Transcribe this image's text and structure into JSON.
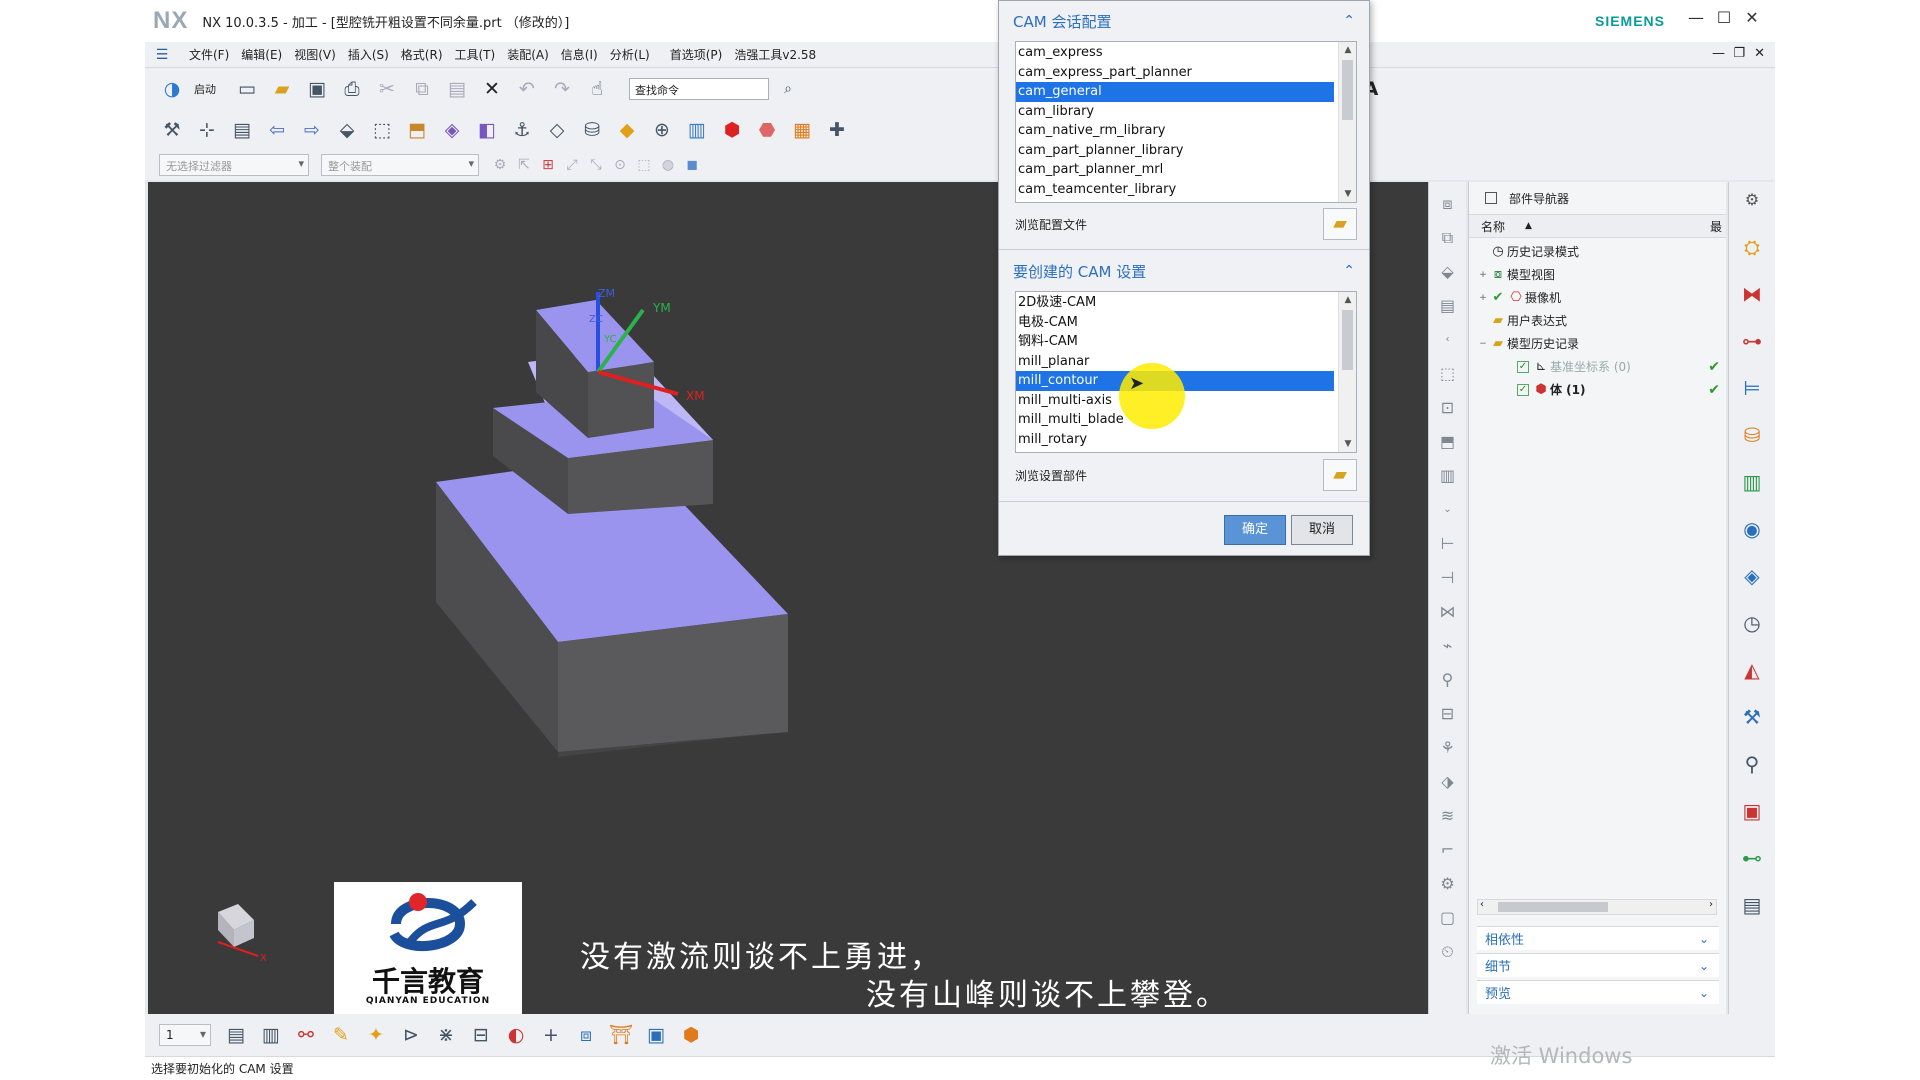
{
  "window": {
    "app_logo": "NX",
    "title": "NX 10.0.3.5 - 加工 - [型腔铣开粗设置不同余量.prt （修改的）]",
    "brand": "SIEMENS",
    "controls": {
      "minimize": "—",
      "maximize": "☐",
      "close": "✕"
    }
  },
  "menu": {
    "items": [
      "文件(F)",
      "编辑(E)",
      "视图(V)",
      "插入(S)",
      "格式(R)",
      "工具(T)",
      "装配(A)",
      "信息(I)",
      "分析(L)",
      "首选项(P)",
      "浩强工具v2.58"
    ],
    "doc_controls": {
      "minimize": "—",
      "restore": "❐",
      "close": "✕"
    }
  },
  "toolbar": {
    "start_label": "启动",
    "search_placeholder": "查找命令",
    "filter_dropdown": "无选择过滤器",
    "assembly_dropdown": "整个装配"
  },
  "dialog": {
    "session_header": "CAM 会话配置",
    "session_items": [
      {
        "label": "cam_express",
        "selected": false
      },
      {
        "label": "cam_express_part_planner",
        "selected": false
      },
      {
        "label": "cam_general",
        "selected": true
      },
      {
        "label": "cam_library",
        "selected": false
      },
      {
        "label": "cam_native_rm_library",
        "selected": false
      },
      {
        "label": "cam_part_planner_library",
        "selected": false
      },
      {
        "label": "cam_part_planner_mrl",
        "selected": false
      },
      {
        "label": "cam_teamcenter_library",
        "selected": false
      }
    ],
    "browse_config_label": "浏览配置文件",
    "setup_header": "要创建的 CAM 设置",
    "setup_items": [
      {
        "label": "2D极速-CAM",
        "selected": false
      },
      {
        "label": "电极-CAM",
        "selected": false
      },
      {
        "label": "钢料-CAM",
        "selected": false
      },
      {
        "label": "mill_planar",
        "selected": false
      },
      {
        "label": "mill_contour",
        "selected": true
      },
      {
        "label": "mill_multi-axis",
        "selected": false
      },
      {
        "label": "mill_multi_blade",
        "selected": false
      },
      {
        "label": "mill_rotary",
        "selected": false
      }
    ],
    "browse_setup_label": "浏览设置部件",
    "ok_label": "确定",
    "cancel_label": "取消"
  },
  "viewport": {
    "axes": {
      "zm": "ZM",
      "ym": "YM",
      "xm": "XM",
      "yc": "YC",
      "zc": "ZC"
    },
    "mini_triad_x": "X",
    "subtitle_line1": "没有激流则谈不上勇进，",
    "subtitle_line2": "没有山峰则谈不上攀登。",
    "logo_cn": "千言教育",
    "logo_en": "QIANYAN EDUCATION",
    "solid_color": "#9a94ee"
  },
  "navigator": {
    "title": "部件导航器",
    "col_name": "名称",
    "col_last": "最",
    "tree": [
      {
        "label": "历史记录模式",
        "icon": "clock-icon",
        "level": 0,
        "expander": ""
      },
      {
        "label": "模型视图",
        "icon": "model-views-icon",
        "level": 0,
        "expander": "+"
      },
      {
        "label": "摄像机",
        "icon": "camera-icon",
        "level": 0,
        "expander": "+"
      },
      {
        "label": "用户表达式",
        "icon": "folder-icon",
        "level": 0,
        "expander": ""
      },
      {
        "label": "模型历史记录",
        "icon": "folder-icon",
        "level": 0,
        "expander": "−"
      },
      {
        "label": "基准坐标系 (0)",
        "icon": "datum-csys-icon",
        "level": 1,
        "expander": "",
        "checked": true
      },
      {
        "label": "体 (1)",
        "icon": "body-icon",
        "level": 1,
        "expander": "",
        "checked": true
      }
    ],
    "sections": [
      "相依性",
      "细节",
      "预览"
    ]
  },
  "bottombar": {
    "layer_value": "1"
  },
  "status": {
    "text": "选择要初始化的 CAM 设置",
    "watermark": "激活 Windows"
  }
}
